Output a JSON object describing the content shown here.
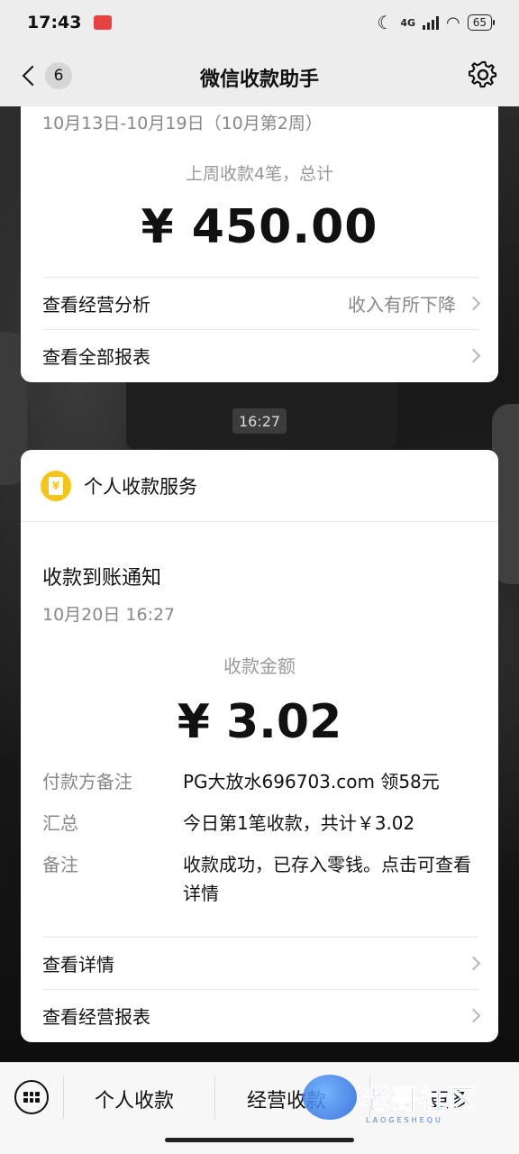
{
  "status_bar": {
    "time": "17:43",
    "network": "4G",
    "battery": "65"
  },
  "nav": {
    "unread_count": "6",
    "title": "微信收款助手"
  },
  "weekly_card": {
    "period": "10月13日-10月19日（10月第2周）",
    "summary": "上周收款4笔，总计",
    "amount": "¥ 450.00",
    "rows": [
      {
        "label": "查看经营分析",
        "value": "收入有所下降"
      },
      {
        "label": "查看全部报表",
        "value": ""
      }
    ]
  },
  "message_time": "16:27",
  "receipt_card": {
    "service_name": "个人收款服务",
    "title": "收款到账通知",
    "datetime": "10月20日 16:27",
    "amount_label": "收款金额",
    "amount": "¥ 3.02",
    "fields": [
      {
        "key": "付款方备注",
        "value": "PG大放水696703.com 领58元"
      },
      {
        "key": "汇总",
        "value": "今日第1笔收款，共计￥3.02"
      },
      {
        "key": "备注",
        "value": "收款成功，已存入零钱。点击可查看详情"
      }
    ],
    "rows": [
      {
        "label": "查看详情"
      },
      {
        "label": "查看经营报表"
      }
    ]
  },
  "bottom_menu": {
    "items": [
      "个人收款",
      "经营收款",
      "更多"
    ]
  },
  "watermark": {
    "text": "老哥社区",
    "sub": "LAOGESHEQU"
  },
  "colors": {
    "service_icon": "#f5c518",
    "background_bar": "#ededed",
    "card": "#ffffff",
    "watermark": "#3b7ff0"
  }
}
